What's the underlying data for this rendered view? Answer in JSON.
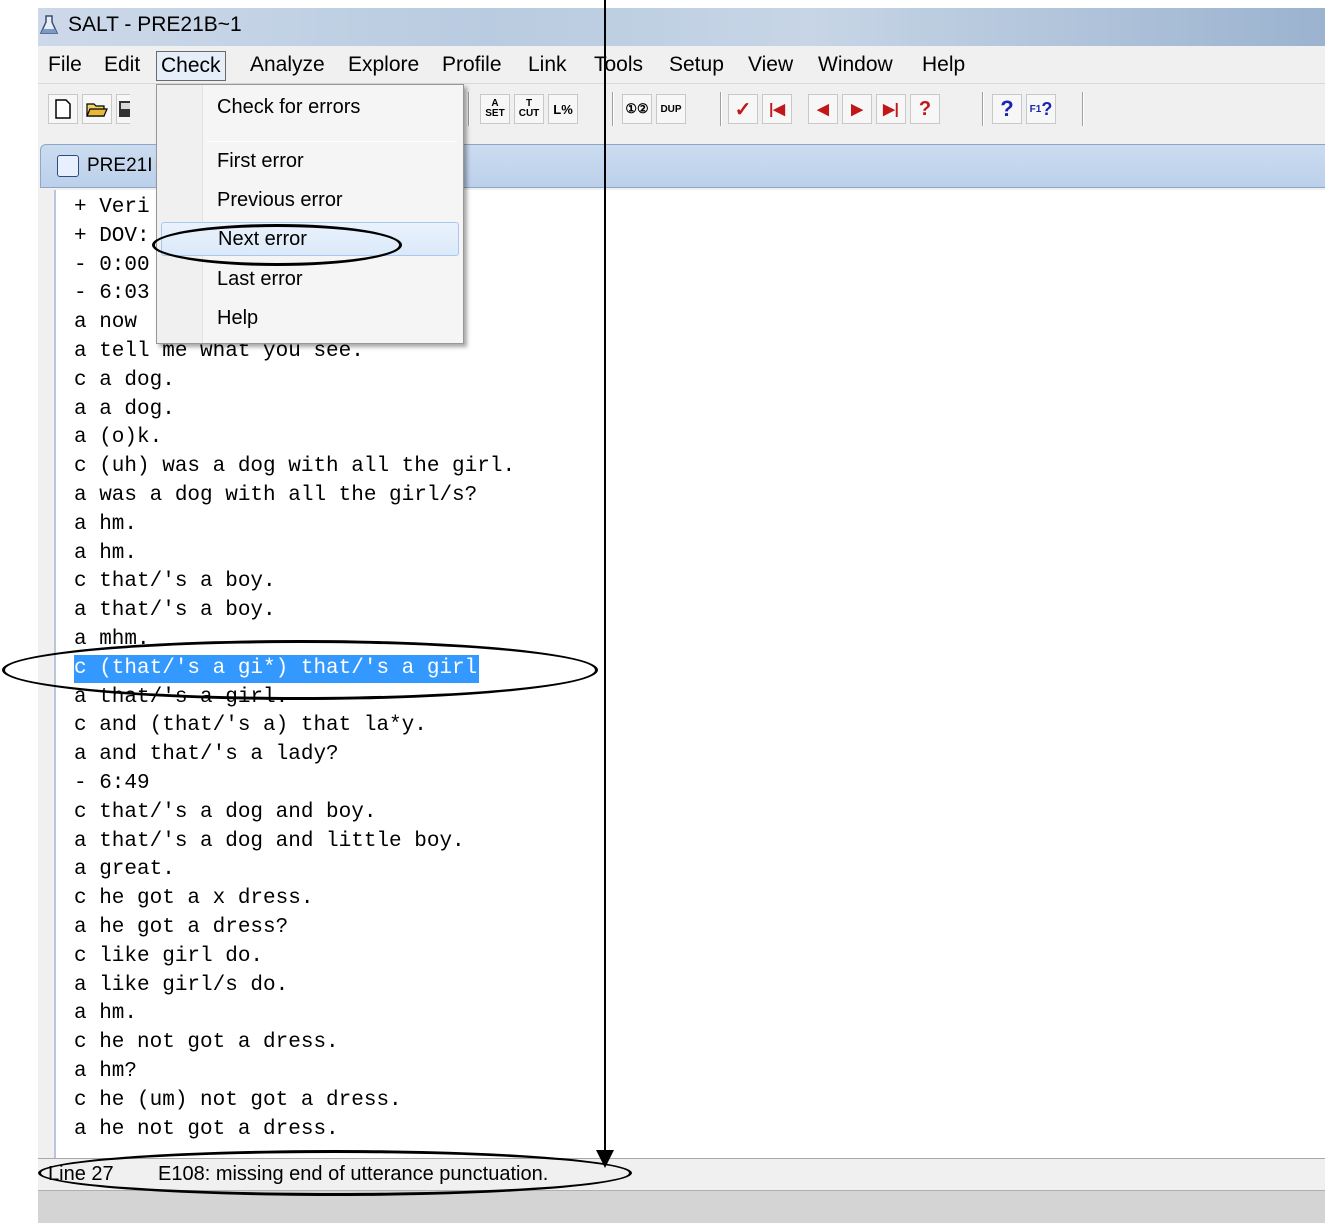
{
  "window": {
    "title": "SALT - PRE21B~1"
  },
  "menubar": {
    "items": [
      "File",
      "Edit",
      "Check",
      "Analyze",
      "Explore",
      "Profile",
      "Link",
      "Tools",
      "Setup",
      "View",
      "Window",
      "Help"
    ],
    "open": "Check"
  },
  "toolbar": {
    "buttons": [
      {
        "name": "new-file-icon",
        "glyph": ""
      },
      {
        "name": "open-folder-icon",
        "glyph": ""
      },
      {
        "name": "save-icon",
        "glyph": ""
      },
      {
        "name": "set-icon",
        "glyph": "A− SET"
      },
      {
        "name": "cut-icon",
        "glyph": "T− CUT"
      },
      {
        "name": "loop-icon",
        "glyph": "L%"
      },
      {
        "name": "compare-icon",
        "glyph": "①②"
      },
      {
        "name": "duplicate-icon",
        "glyph": "DUP"
      },
      {
        "name": "check-icon",
        "glyph": "✓"
      },
      {
        "name": "first-error-icon",
        "glyph": "|◀"
      },
      {
        "name": "previous-error-icon",
        "glyph": "◀"
      },
      {
        "name": "next-error-icon",
        "glyph": "▶"
      },
      {
        "name": "last-error-icon",
        "glyph": "▶|"
      },
      {
        "name": "check-help-icon",
        "glyph": "?"
      },
      {
        "name": "help-icon",
        "glyph": "?"
      },
      {
        "name": "context-help-icon",
        "glyph": "F1?"
      }
    ]
  },
  "check_menu": {
    "items": [
      "Check for errors",
      "First error",
      "Previous error",
      "Next error",
      "Last error",
      "Help"
    ],
    "highlighted": "Next error"
  },
  "document": {
    "tab_title": "PRE21I",
    "lines": [
      "+ Veri",
      "+ DOV:",
      "- 0:00",
      "- 6:03",
      "a now",
      "a tell me what you see.",
      "c a dog.",
      "a a dog.",
      "a (o)k.",
      "c (uh) was a dog with all the girl.",
      "a was a dog with all the girl/s?",
      "a hm.",
      "a hm.",
      "c that/'s a boy.",
      "a that/'s a boy.",
      "a mhm.",
      "c (that/'s a gi*) that/'s a girl",
      "a that/'s a girl.",
      "c and (that/'s a) that la*y.",
      "a and that/'s a lady?",
      "- 6:49",
      "c that/'s a dog and boy.",
      "a that/'s a dog and little boy.",
      "a great.",
      "c he got a x dress.",
      "a he got a dress?",
      "c like girl do.",
      "a like girl/s do.",
      "a hm.",
      "c he not got a dress.",
      "a hm?",
      "c he (um) not got a dress.",
      "a he not got a dress."
    ],
    "selected_line": 16
  },
  "status": {
    "line": "Line 27",
    "message": "E108: missing end of utterance punctuation."
  },
  "colors": {
    "selection": "#3399ff",
    "titlebar": "#b9cbe0",
    "error_red": "#c0171b"
  }
}
